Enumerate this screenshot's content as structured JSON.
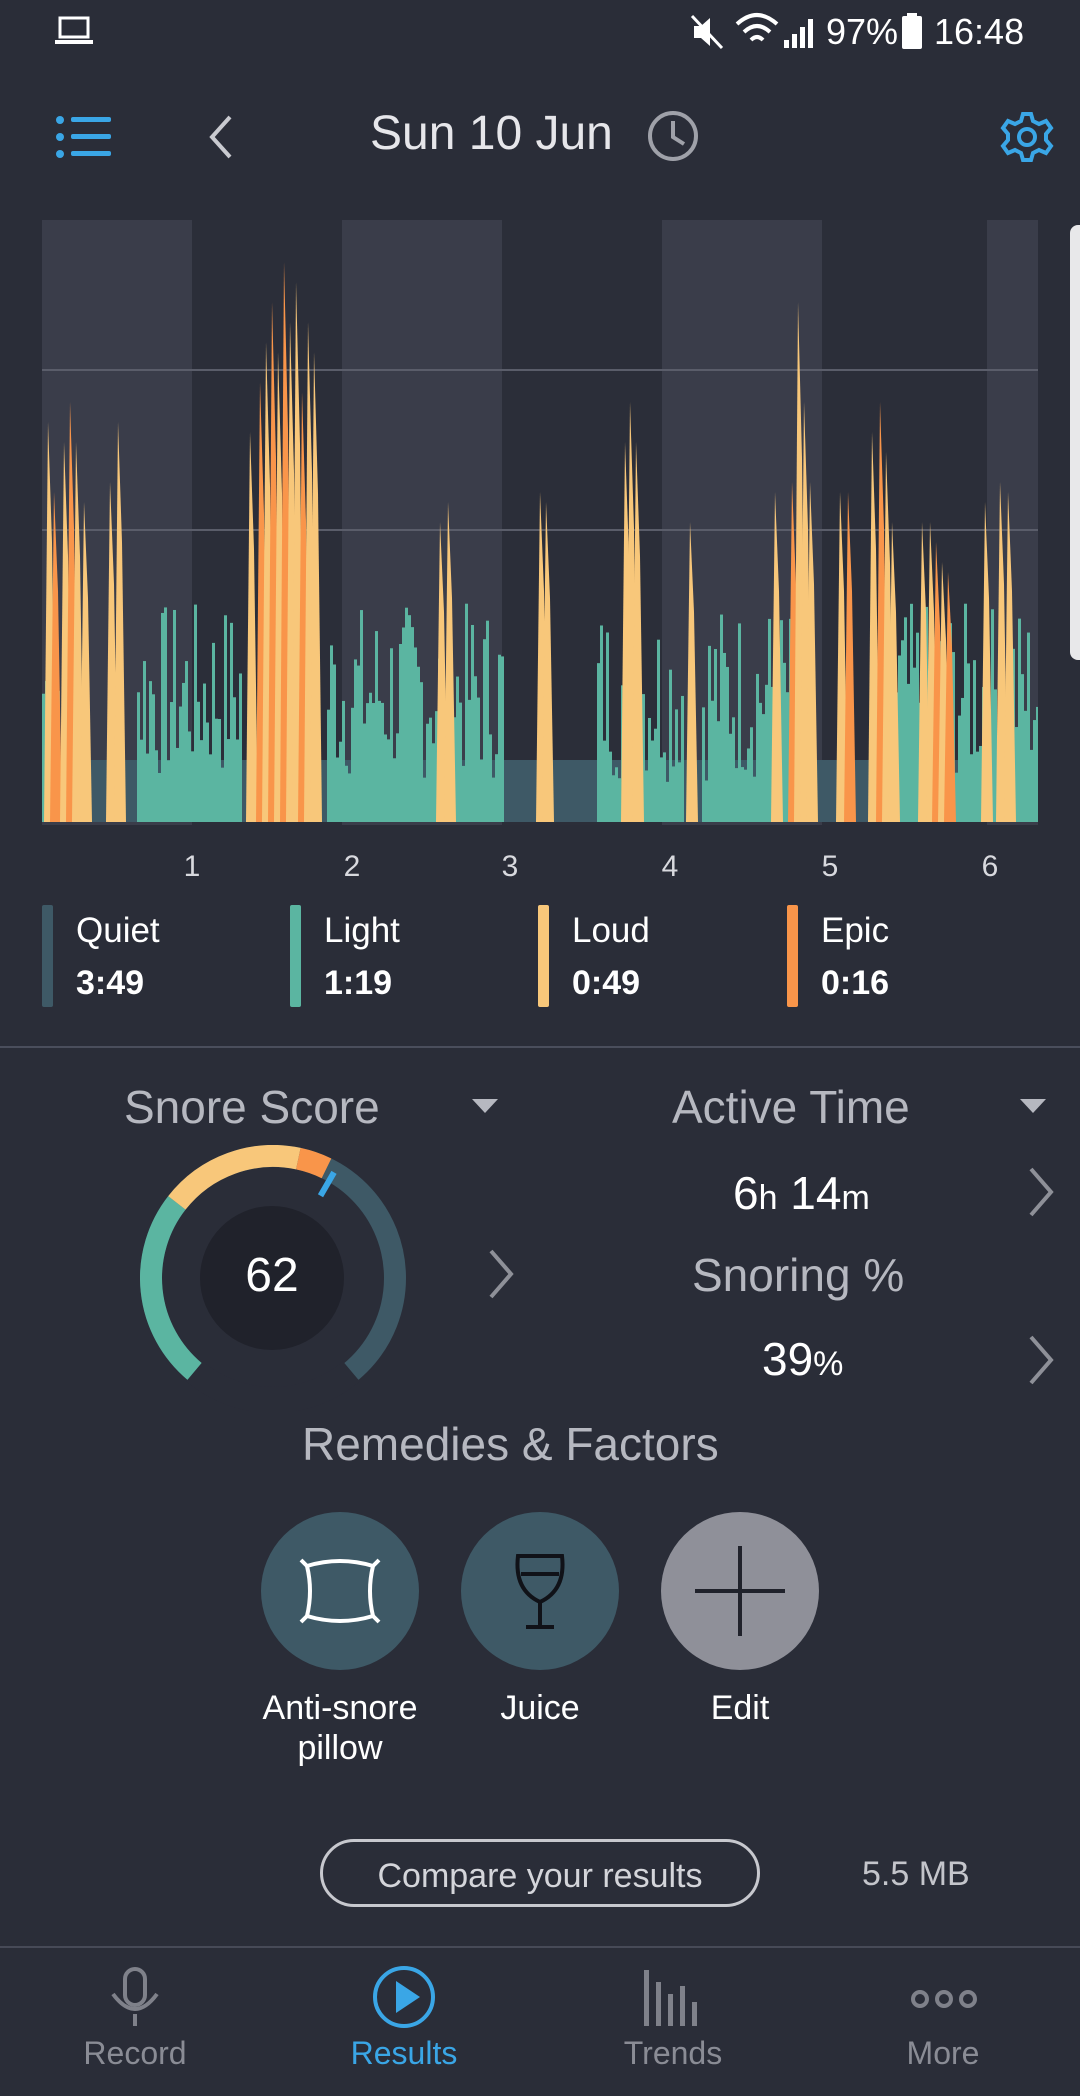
{
  "status_bar": {
    "battery": "97%",
    "time": "16:48"
  },
  "header": {
    "title": "Sun 10 Jun"
  },
  "chart_data": {
    "type": "area",
    "x_ticks": [
      "1",
      "2",
      "3",
      "4",
      "5",
      "6"
    ],
    "levels": [
      "Quiet",
      "Light",
      "Loud",
      "Epic"
    ],
    "colors": {
      "Quiet": "#3e5966",
      "Light": "#5bb5a1",
      "Loud": "#f8c77a",
      "Epic": "#f9954a"
    },
    "grid": true
  },
  "legend": [
    {
      "name": "Quiet",
      "value": "3:49",
      "color": "#3e5966"
    },
    {
      "name": "Light",
      "value": "1:19",
      "color": "#5bb5a1"
    },
    {
      "name": "Loud",
      "value": "0:49",
      "color": "#f8c77a"
    },
    {
      "name": "Epic",
      "value": "0:16",
      "color": "#f9954a"
    }
  ],
  "score": {
    "title": "Snore Score",
    "value": "62"
  },
  "active": {
    "title": "Active Time",
    "hours": "6",
    "h_unit": "h",
    "minutes": "14",
    "m_unit": "m",
    "snoring_title": "Snoring %",
    "snoring_value": "39",
    "snoring_unit": "%"
  },
  "remedies": {
    "title": "Remedies & Factors",
    "items": [
      {
        "label_line1": "Anti-snore",
        "label_line2": "pillow",
        "icon": "pillow-icon"
      },
      {
        "label_line1": "Juice",
        "icon": "wine-glass-icon"
      },
      {
        "label_line1": "Edit",
        "icon": "plus-icon"
      }
    ]
  },
  "compare": {
    "label": "Compare your results",
    "size": "5.5 MB"
  },
  "tabs": [
    {
      "label": "Record",
      "icon": "microphone-icon"
    },
    {
      "label": "Results",
      "icon": "play-icon",
      "active": true
    },
    {
      "label": "Trends",
      "icon": "bars-icon"
    },
    {
      "label": "More",
      "icon": "dots-icon"
    }
  ]
}
